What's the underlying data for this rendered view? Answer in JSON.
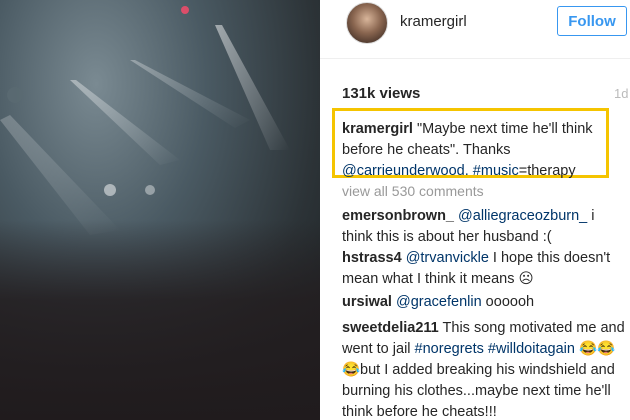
{
  "post": {
    "username": "kramergirl",
    "follow_label": "Follow",
    "views": "131k views",
    "time": "1d"
  },
  "caption": {
    "user": "kramergirl",
    "text1": "\"Maybe next time he'll think before he cheats\". Thanks",
    "mention": "@carrieunderwood.",
    "hashtag": "#music",
    "text2": "=therapy"
  },
  "view_all_comments": "view all 530 comments",
  "comments": [
    {
      "user": "emersonbrown_",
      "mention": "@alliegraceozburn_",
      "text": " i think this is about her husband :("
    },
    {
      "user": "hstrass4",
      "mention": "@trvanvickle",
      "text": " I hope this doesn't mean what I think it means ☹"
    },
    {
      "user": "ursiwal",
      "mention": "@gracefenlin",
      "text": " oooooh"
    },
    {
      "user": "sweetdelia211",
      "text1": " This song motivated me and went to jail ",
      "tag1": "#noregrets",
      "tag2": "#willdoitagain",
      "text2": " 😂😂😂but I added breaking his windshield and burning his clothes...maybe next time he'll think before he cheats!!!"
    }
  ]
}
